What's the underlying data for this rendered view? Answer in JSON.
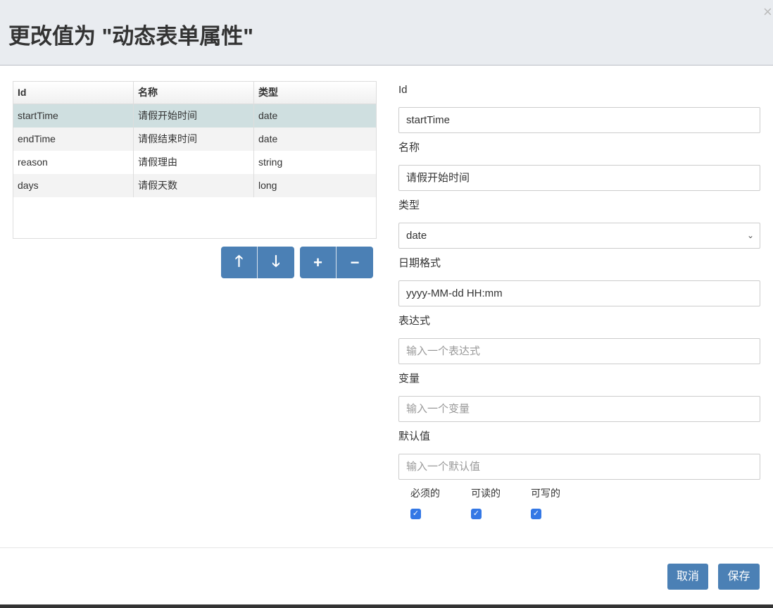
{
  "dialog": {
    "title": "更改值为 \"动态表单属性\"",
    "close": "×"
  },
  "table": {
    "columns": [
      "Id",
      "名称",
      "类型"
    ],
    "rows": [
      [
        "startTime",
        "请假开始时间",
        "date"
      ],
      [
        "endTime",
        "请假结束时间",
        "date"
      ],
      [
        "reason",
        "请假理由",
        "string"
      ],
      [
        "days",
        "请假天数",
        "long"
      ]
    ],
    "selected_row": 0
  },
  "buttons": {
    "up": "🡑",
    "down": "🡓",
    "add": "+",
    "remove": "−"
  },
  "form": {
    "id": {
      "label": "Id",
      "value": "startTime"
    },
    "name": {
      "label": "名称",
      "value": "请假开始时间"
    },
    "type": {
      "label": "类型",
      "value": "date"
    },
    "date_format": {
      "label": "日期格式",
      "value": "yyyy-MM-dd HH:mm"
    },
    "expression": {
      "label": "表达式",
      "placeholder": "输入一个表达式"
    },
    "variable": {
      "label": "变量",
      "placeholder": "输入一个变量"
    },
    "default": {
      "label": "默认值",
      "placeholder": "输入一个默认值"
    },
    "required": {
      "label": "必须的",
      "checked": true
    },
    "readable": {
      "label": "可读的",
      "checked": true
    },
    "writable": {
      "label": "可写的",
      "checked": true
    }
  },
  "footer": {
    "cancel": "取消",
    "save": "保存"
  },
  "colors": {
    "accent": "#4b80b5",
    "selected_row": "#cfdfe0",
    "checkbox": "#3478e5"
  }
}
